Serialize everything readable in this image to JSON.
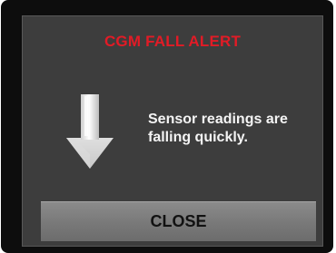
{
  "alert": {
    "title": "CGM FALL ALERT",
    "icon": "down-arrow-icon",
    "message": "Sensor readings are\nfalling quickly.",
    "close_label": "CLOSE"
  },
  "colors": {
    "title": "#e21b26",
    "panel_background": "#3d3d3d",
    "button_background": "#7a7a7a"
  }
}
